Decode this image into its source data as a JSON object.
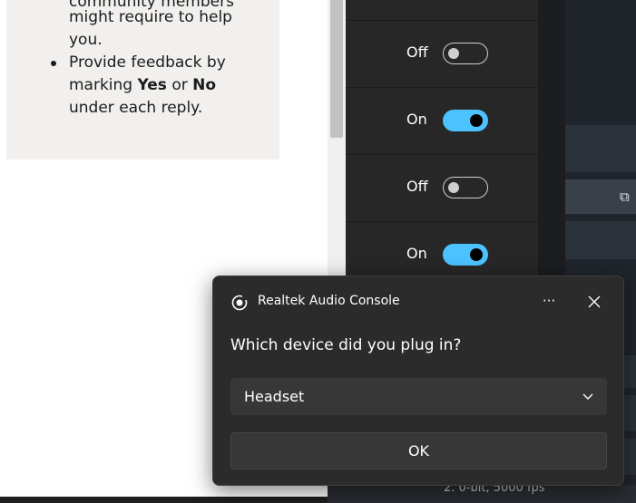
{
  "tips": {
    "lines": [
      "community members",
      "might require to help",
      "you."
    ],
    "bullet2_lines": [
      "Provide feedback by",
      "under each reply."
    ],
    "marking_prefix": "marking ",
    "yes": "Yes",
    "or": " or ",
    "no": "No"
  },
  "settings_rows": [
    {
      "label": "Off",
      "state": "off"
    },
    {
      "label": "On",
      "state": "on"
    },
    {
      "label": "Off",
      "state": "off"
    },
    {
      "label": "On",
      "state": "on"
    }
  ],
  "background": {
    "status_text": "2. 0-bit, 5000 fps"
  },
  "dialog": {
    "app_name": "Realtek Audio Console",
    "more_label": "···",
    "question": "Which device did you plug in?",
    "selected_device": "Headset",
    "ok_label": "OK"
  },
  "colors": {
    "toggle_on": "#4cc2ff",
    "dialog_bg": "#2b2b2b",
    "panel_bg": "#272727"
  }
}
